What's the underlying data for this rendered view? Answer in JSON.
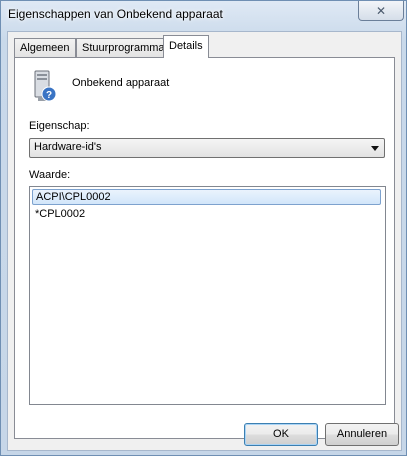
{
  "window": {
    "title": "Eigenschappen van Onbekend apparaat",
    "close_label": "✕"
  },
  "tabs": [
    {
      "label": "Algemeen",
      "active": false
    },
    {
      "label": "Stuurprogramma",
      "active": false
    },
    {
      "label": "Details",
      "active": true
    }
  ],
  "device": {
    "name": "Onbekend apparaat",
    "icon": "unknown-device-icon"
  },
  "property": {
    "label": "Eigenschap:",
    "selected": "Hardware-id's"
  },
  "values": {
    "label": "Waarde:",
    "items": [
      {
        "text": "ACPI\\CPL0002",
        "selected": true
      },
      {
        "text": "*CPL0002",
        "selected": false
      }
    ]
  },
  "buttons": {
    "ok": "OK",
    "cancel": "Annuleren"
  }
}
